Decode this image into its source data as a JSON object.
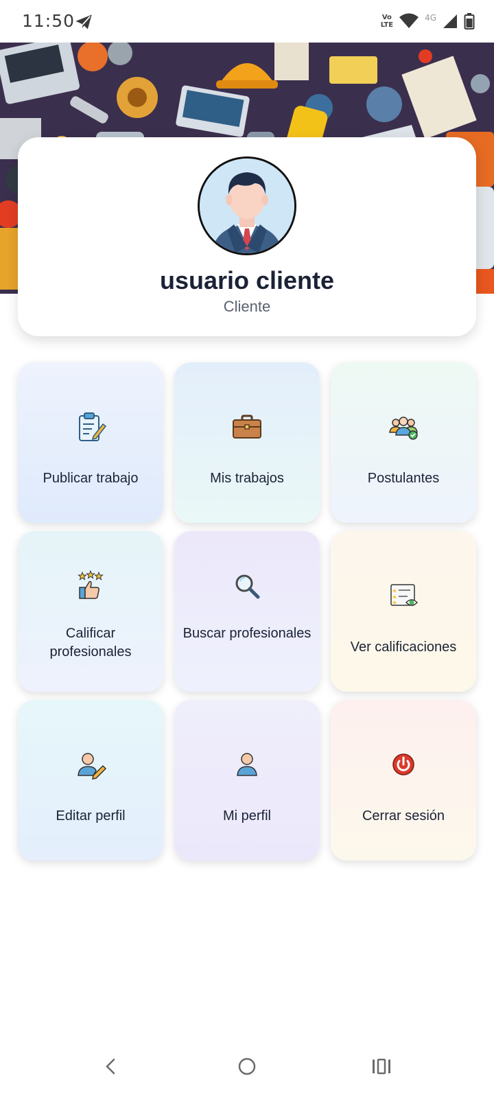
{
  "status_bar": {
    "time": "11:50",
    "volte_top": "Vo",
    "volte_bottom": "LTE",
    "network": "4G",
    "icons": [
      "telegram-send-icon",
      "wifi-icon",
      "signal-icon",
      "battery-icon"
    ]
  },
  "profile": {
    "name": "usuario cliente",
    "role": "Cliente",
    "avatar_icon": "businessman-avatar-icon"
  },
  "menu": {
    "items": [
      {
        "label": "Publicar trabajo",
        "icon": "clipboard-edit-icon",
        "bg_top": "#eef3fd",
        "bg_bottom": "#dfeafc"
      },
      {
        "label": "Mis trabajos",
        "icon": "briefcase-icon",
        "bg_top": "#e3eefb",
        "bg_bottom": "#eaf8f7"
      },
      {
        "label": "Postulantes",
        "icon": "applicants-icon",
        "bg_top": "#eef9f4",
        "bg_bottom": "#eef3fc"
      },
      {
        "label": "Calificar profesionales",
        "icon": "thumbs-up-stars-icon",
        "bg_top": "#e5f4f8",
        "bg_bottom": "#eef2fd"
      },
      {
        "label": "Buscar profesionales",
        "icon": "magnifier-icon",
        "bg_top": "#ece8fa",
        "bg_bottom": "#eef1fd"
      },
      {
        "label": "Ver calificaciones",
        "icon": "rating-list-eye-icon",
        "bg_top": "#fdf6ec",
        "bg_bottom": "#fdf8ea"
      },
      {
        "label": "Editar perfil",
        "icon": "edit-user-icon",
        "bg_top": "#e6f7fa",
        "bg_bottom": "#e4eefc"
      },
      {
        "label": "Mi perfil",
        "icon": "user-icon",
        "bg_top": "#efeefb",
        "bg_bottom": "#ebe8fb"
      },
      {
        "label": "Cerrar sesión",
        "icon": "power-icon",
        "bg_top": "#fdf0ef",
        "bg_bottom": "#fdf8ec"
      }
    ]
  },
  "nav": {
    "icons": [
      "back-icon",
      "home-icon",
      "recents-icon"
    ]
  }
}
